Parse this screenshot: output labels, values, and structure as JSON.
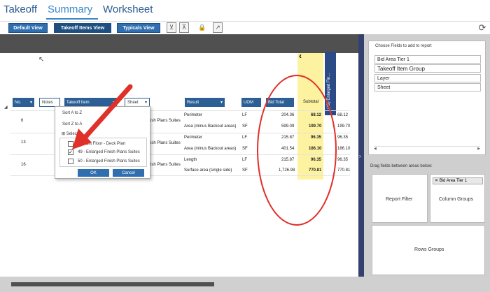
{
  "tabs": [
    "Takeoff",
    "Summary",
    "Worksheet"
  ],
  "toolbar": {
    "default_view": "Default View",
    "takeoff_items_view": "Takeoff Items View",
    "typicals_view": "Typicals View"
  },
  "grid": {
    "headers": {
      "no": "No.",
      "notes": "Notes",
      "takeoff_item": "Takeoff Item",
      "sheet": "Sheet",
      "result": "Result",
      "uom": "UOM",
      "bid_total": "Bid Total",
      "subtotal": "Subtotal",
      "enlarged": "(49) Enlarged Fin..."
    },
    "group_numbers": [
      "6",
      "13",
      "16"
    ],
    "sheet_fragments": [
      "ish Plans Suites",
      "ish Plans Suites",
      "ish Plans Suites"
    ],
    "rows": [
      {
        "result": "Perimeter",
        "uom": "LF",
        "bid_total": "204.36",
        "subtotal": "68.12",
        "last": "68.12"
      },
      {
        "result": "Area (minus Backout areas)",
        "uom": "SF",
        "bid_total": "599.09",
        "subtotal": "199.70",
        "last": "199.70"
      },
      {
        "result": "Perimeter",
        "uom": "LF",
        "bid_total": "215.87",
        "subtotal": "96.35",
        "last": "96.35"
      },
      {
        "result": "Area (minus Backout areas)",
        "uom": "SF",
        "bid_total": "401.54",
        "subtotal": "186.10",
        "last": "186.10"
      },
      {
        "result": "Length",
        "uom": "LF",
        "bid_total": "215.87",
        "subtotal": "96.35",
        "last": "96.35"
      },
      {
        "result": "Surface area (single side)",
        "uom": "SF",
        "bid_total": "1,726.98",
        "subtotal": "770.81",
        "last": "770.81"
      }
    ]
  },
  "filter_popup": {
    "sort_az": "Sort A to Z",
    "sort_za": "Sort Z to A",
    "select_all": "Select",
    "options": [
      {
        "label": "25 - 1st Floor - Deck Plan",
        "checked": false
      },
      {
        "label": "49 - Enlarged Finish Plans Suites",
        "checked": true
      },
      {
        "label": "50 - Enlarged Finish Plans Suites",
        "checked": false
      }
    ],
    "ok": "OK",
    "cancel": "Cancel"
  },
  "right_panel": {
    "choose_title": "Choose Fields to add to report",
    "fields": [
      "Bid Area Tier 1",
      "Takeoff Item Group",
      "Layer",
      "Sheet"
    ],
    "drag_title": "Drag fields between areas below:",
    "report_filter": "Report Filter",
    "column_groups": "Column Groups",
    "column_chip": "Bid Area Tier 1",
    "rows_groups": "Rows Groups"
  },
  "colors": {
    "accent": "#3c87c8",
    "header_blue": "#2b5f95",
    "highlight_yellow": "#fdf2a0",
    "annotation_red": "#e0302a"
  }
}
